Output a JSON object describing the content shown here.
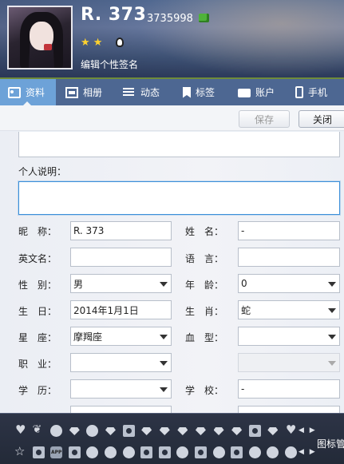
{
  "profile": {
    "nickname": "R. 373",
    "uin": "3735998",
    "level_stars": "★ ★",
    "signature_placeholder": "编辑个性签名"
  },
  "tabs": [
    {
      "label": "资料",
      "icon": "profile-card-icon",
      "active": true
    },
    {
      "label": "相册",
      "icon": "photo-icon"
    },
    {
      "label": "动态",
      "icon": "feed-list-icon"
    },
    {
      "label": "标签",
      "icon": "bookmark-tag-icon"
    },
    {
      "label": "账户",
      "icon": "wallet-icon"
    },
    {
      "label": "手机",
      "icon": "phone-icon"
    }
  ],
  "actions": {
    "save": "保存",
    "close": "关闭"
  },
  "form": {
    "desc_label": "个人说明：",
    "desc_value": "",
    "fields": {
      "nickname": {
        "label": "昵　称：",
        "value": "R. 373"
      },
      "name": {
        "label": "姓　名：",
        "value": "-"
      },
      "english_name": {
        "label": "英文名：",
        "value": ""
      },
      "language": {
        "label": "语　言：",
        "value": ""
      },
      "gender": {
        "label": "性　别：",
        "value": "男"
      },
      "age": {
        "label": "年　龄：",
        "value": "0"
      },
      "birthday": {
        "label": "生　日：",
        "value": "2014年1月1日"
      },
      "zodiac": {
        "label": "生　肖：",
        "value": "蛇"
      },
      "constellation": {
        "label": "星　座：",
        "value": "摩羯座"
      },
      "blood": {
        "label": "血　型：",
        "value": ""
      },
      "job": {
        "label": "职　业：",
        "value": ""
      },
      "job_sub": {
        "value": ""
      },
      "education": {
        "label": "学　历：",
        "value": ""
      },
      "school": {
        "label": "学　校：",
        "value": "-"
      }
    }
  },
  "dock": {
    "label": "图标管",
    "colors": {
      "background": "#232a38",
      "accent": "#6da2d8"
    }
  }
}
